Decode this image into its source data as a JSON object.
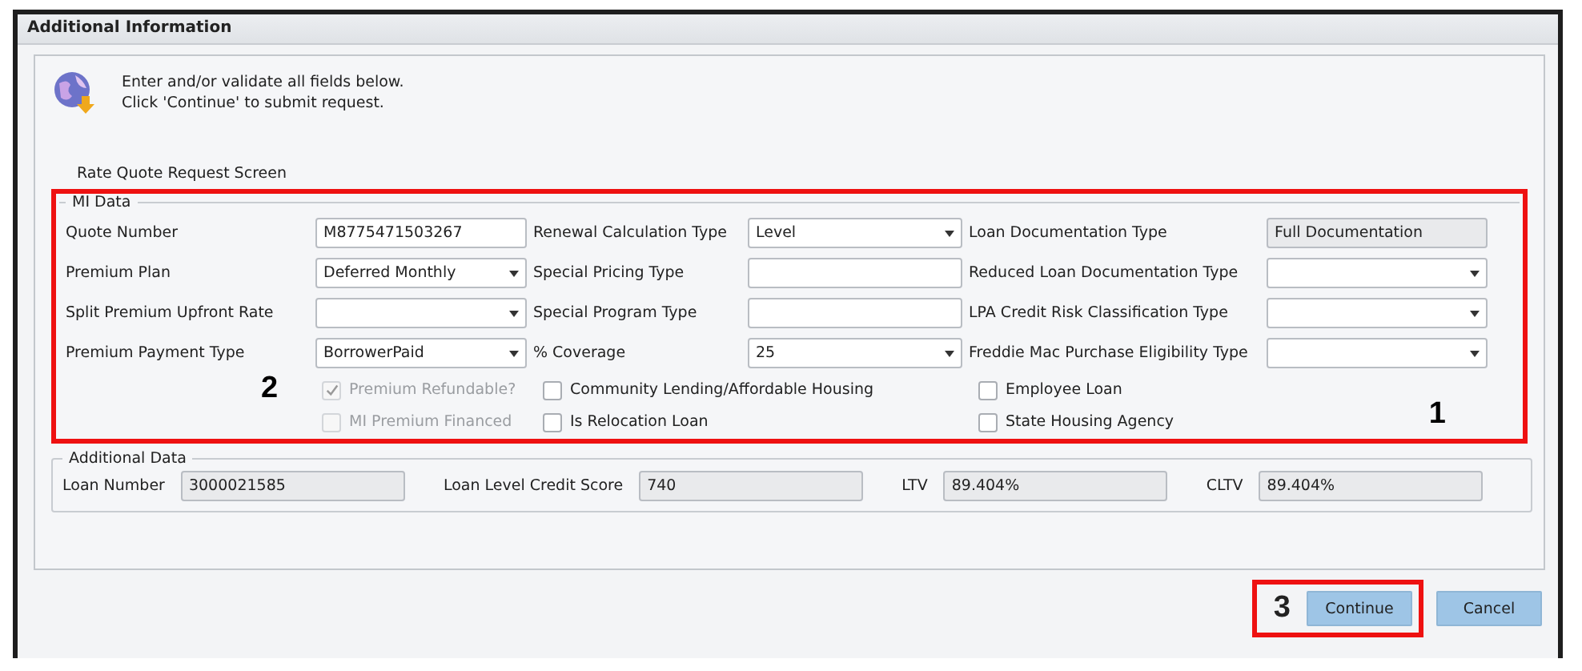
{
  "window": {
    "title": "Additional Information"
  },
  "intro": {
    "lines": [
      "Enter and/or validate all fields below.",
      "Click 'Continue' to submit request."
    ]
  },
  "screen_title": "Rate Quote Request Screen",
  "mi_data": {
    "title": "MI Data",
    "rows": [
      [
        {
          "label": "Quote Number",
          "kind": "text",
          "value": "M8775471503267"
        },
        {
          "label": "Renewal Calculation Type",
          "kind": "select",
          "value": "Level"
        },
        {
          "label": "Loan Documentation Type",
          "kind": "readonly",
          "value": "Full Documentation"
        }
      ],
      [
        {
          "label": "Premium Plan",
          "kind": "select",
          "value": "Deferred Monthly"
        },
        {
          "label": "Special Pricing Type",
          "kind": "text"
        },
        {
          "label": "Reduced Loan Documentation Type",
          "kind": "select"
        }
      ],
      [
        {
          "label": "Split Premium Upfront Rate",
          "kind": "select"
        },
        {
          "label": "Special Program Type",
          "kind": "text"
        },
        {
          "label": "LPA Credit Risk Classification Type",
          "kind": "select"
        }
      ],
      [
        {
          "label": "Premium Payment Type",
          "kind": "select",
          "value": "BorrowerPaid"
        },
        {
          "label": "% Coverage",
          "kind": "select",
          "value": "25"
        },
        {
          "label": "Freddie Mac Purchase Eligibility Type",
          "kind": "select"
        }
      ]
    ],
    "checkbox_columns": [
      [
        {
          "label": "Premium Refundable?",
          "checked": true,
          "disabled": true
        },
        {
          "label": "MI Premium Financed",
          "checked": false,
          "disabled": true
        }
      ],
      [
        {
          "label": "Community Lending/Affordable Housing",
          "checked": false,
          "disabled": false
        },
        {
          "label": "Is Relocation Loan",
          "checked": false,
          "disabled": false
        }
      ],
      [
        {
          "label": "Employee Loan",
          "checked": false,
          "disabled": false
        },
        {
          "label": "State Housing Agency",
          "checked": false,
          "disabled": false
        }
      ]
    ]
  },
  "additional_data": {
    "title": "Additional Data",
    "fields": [
      {
        "label": "Loan Number",
        "value": "3000021585"
      },
      {
        "label": "Loan Level Credit Score",
        "value": "740"
      },
      {
        "label": "LTV",
        "value": "89.404%"
      },
      {
        "label": "CLTV",
        "value": "89.404%"
      }
    ]
  },
  "buttons": [
    {
      "label": "Continue"
    },
    {
      "label": "Cancel"
    }
  ],
  "annotations": [
    "1",
    "2",
    "3"
  ]
}
